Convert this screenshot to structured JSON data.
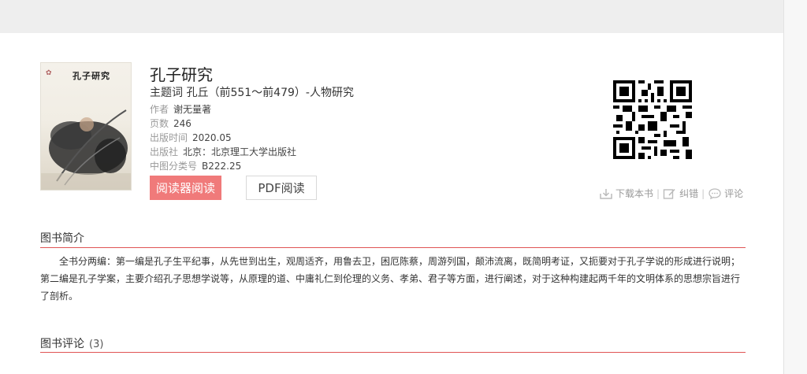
{
  "book": {
    "cover_title": "孔子研究",
    "title": "孔子研究",
    "subject": "主题词 孔丘（前551～前479）-人物研究",
    "meta": [
      {
        "label": "作者",
        "value": "谢无量著"
      },
      {
        "label": "页数",
        "value": "246"
      },
      {
        "label": "出版时间",
        "value": "2020.05"
      },
      {
        "label": "出版社",
        "value": "北京：北京理工大学出版社"
      },
      {
        "label": "中图分类号",
        "value": "B222.25"
      }
    ]
  },
  "buttons": {
    "reader": "阅读器阅读",
    "pdf": "PDF阅读"
  },
  "actions": {
    "download": "下载本书",
    "correct": "纠错",
    "comment": "评论"
  },
  "intro": {
    "heading": "图书简介",
    "text": "全书分两编：第一编是孔子生平纪事，从先世到出生，观周适齐，用鲁去卫，困厄陈蔡，周游列国，颠沛流离，既简明考证，又扼要对于孔子学说的形成进行说明；第二编是孔子学案，主要介绍孔子思想学说等，从原理的道、中庸礼仁到伦理的义务、孝弟、君子等方面，进行阐述，对于这种构建起两千年的文明体系的思想宗旨进行了剖析。"
  },
  "reviews": {
    "heading": "图书评论",
    "count": "(3)"
  },
  "colors": {
    "accent_red": "#e05454",
    "reader_button": "#f07a7a"
  }
}
